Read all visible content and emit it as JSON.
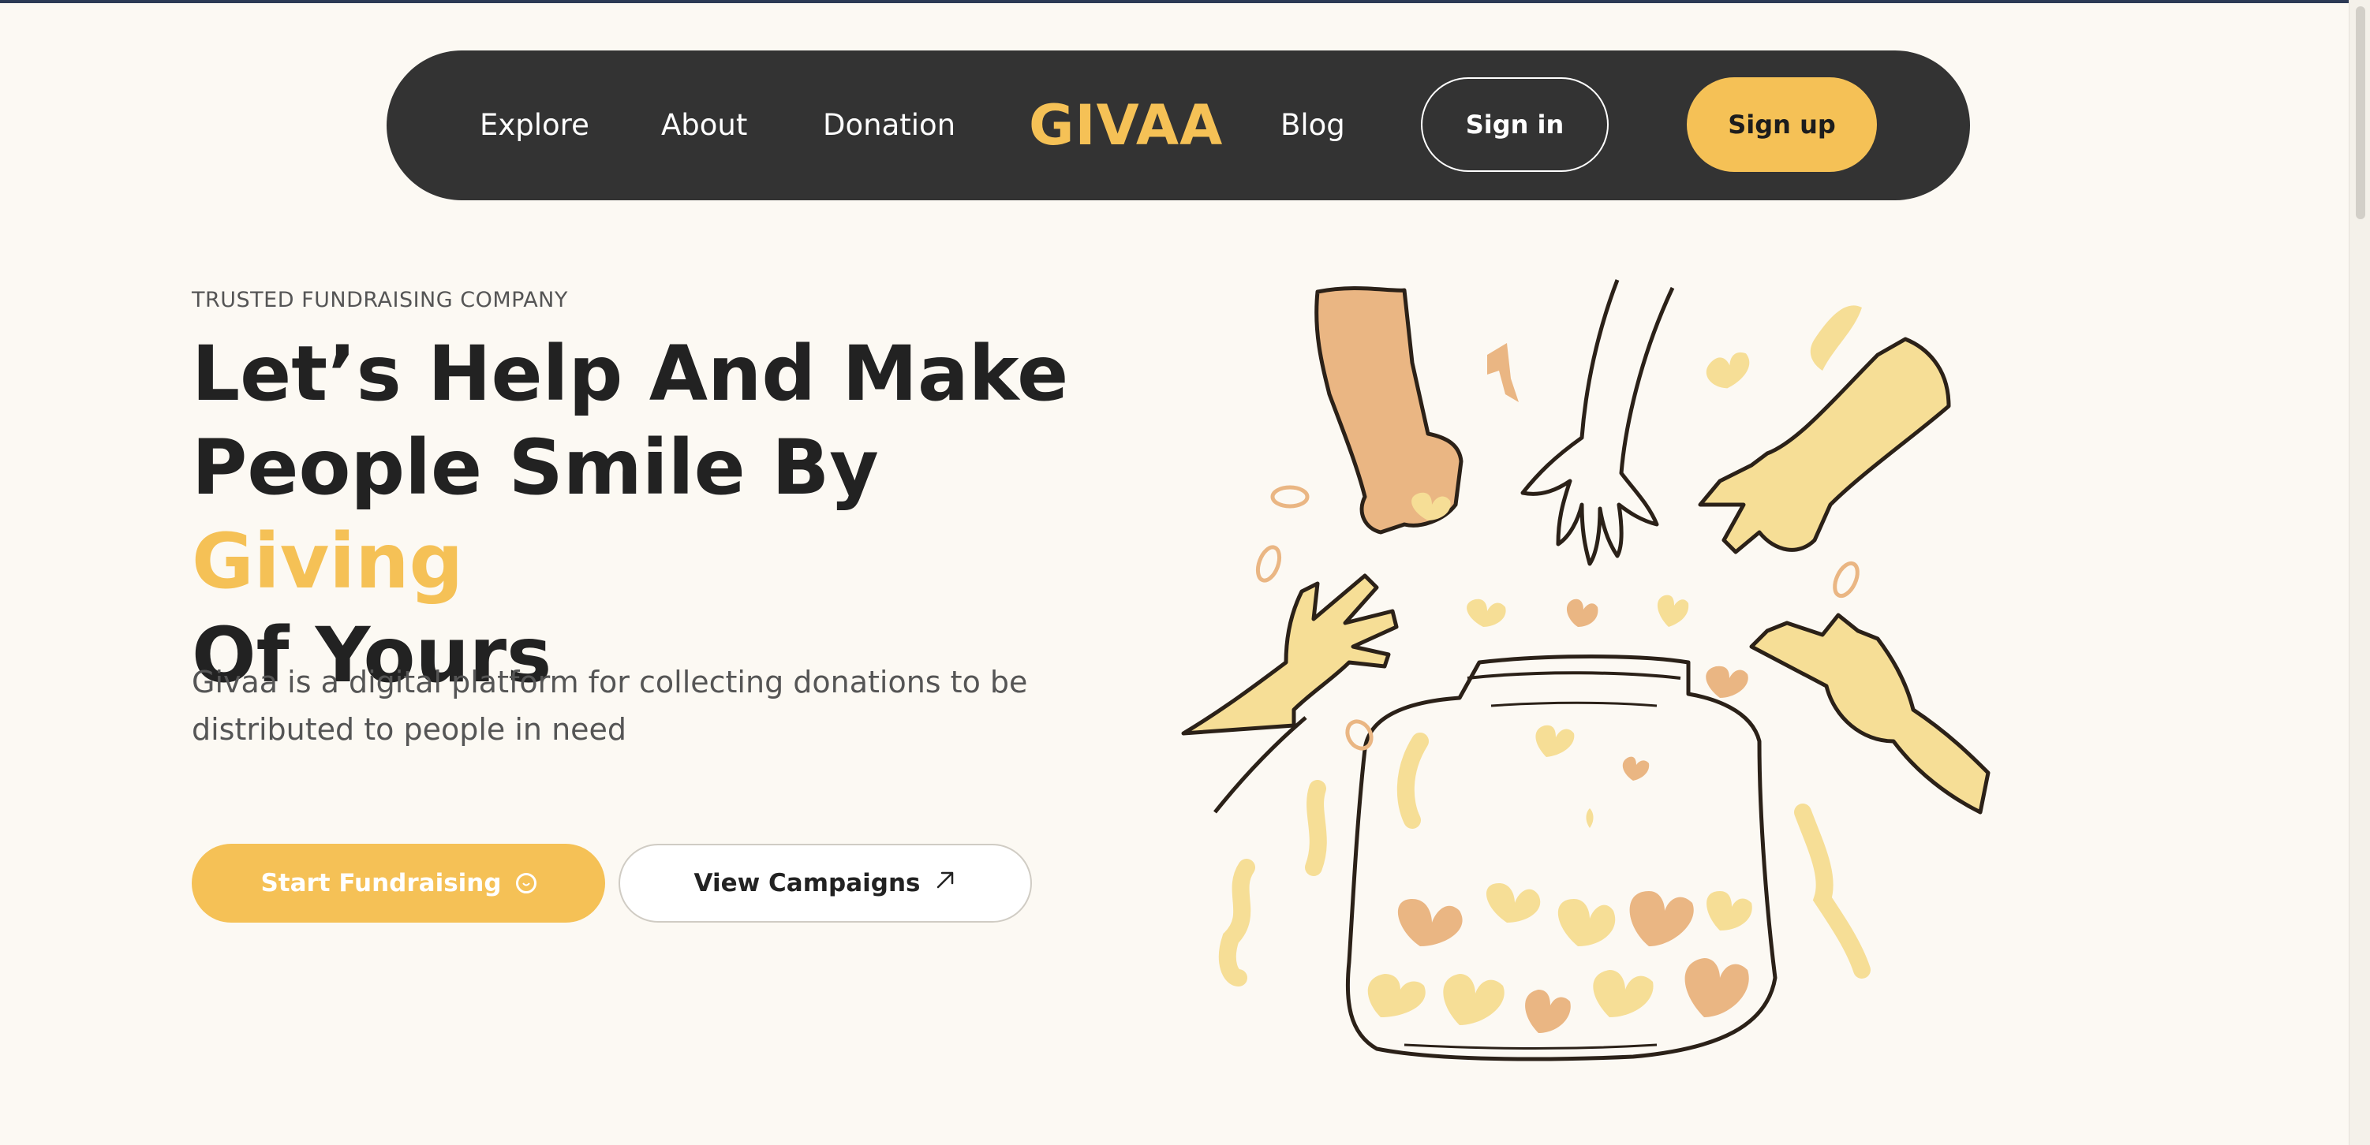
{
  "nav": {
    "links": [
      "Explore",
      "About",
      "Donation",
      "Blog"
    ],
    "brand": "GIVAA",
    "signin_label": "Sign in",
    "signup_label": "Sign up"
  },
  "hero": {
    "eyebrow": "TRUSTED FUNDRAISING COMPANY",
    "headline_line1": "Let’s Help And Make",
    "headline_line2_pre": "People Smile By ",
    "headline_line2_accent": "Giving",
    "headline_line3": "Of Yours",
    "description": "Givaa is a digital platform for collecting donations to be distributed to people in need",
    "primary_button": "Start Fundraising",
    "secondary_button": "View Campaigns"
  },
  "icons": {
    "primary_button_icon": "smile-icon",
    "secondary_button_icon": "arrow-up-right-icon",
    "illustration": "donation-jar-illustration"
  },
  "colors": {
    "accent": "#f5c156",
    "nav_background": "#333333",
    "page_background": "#fcf9f3"
  }
}
